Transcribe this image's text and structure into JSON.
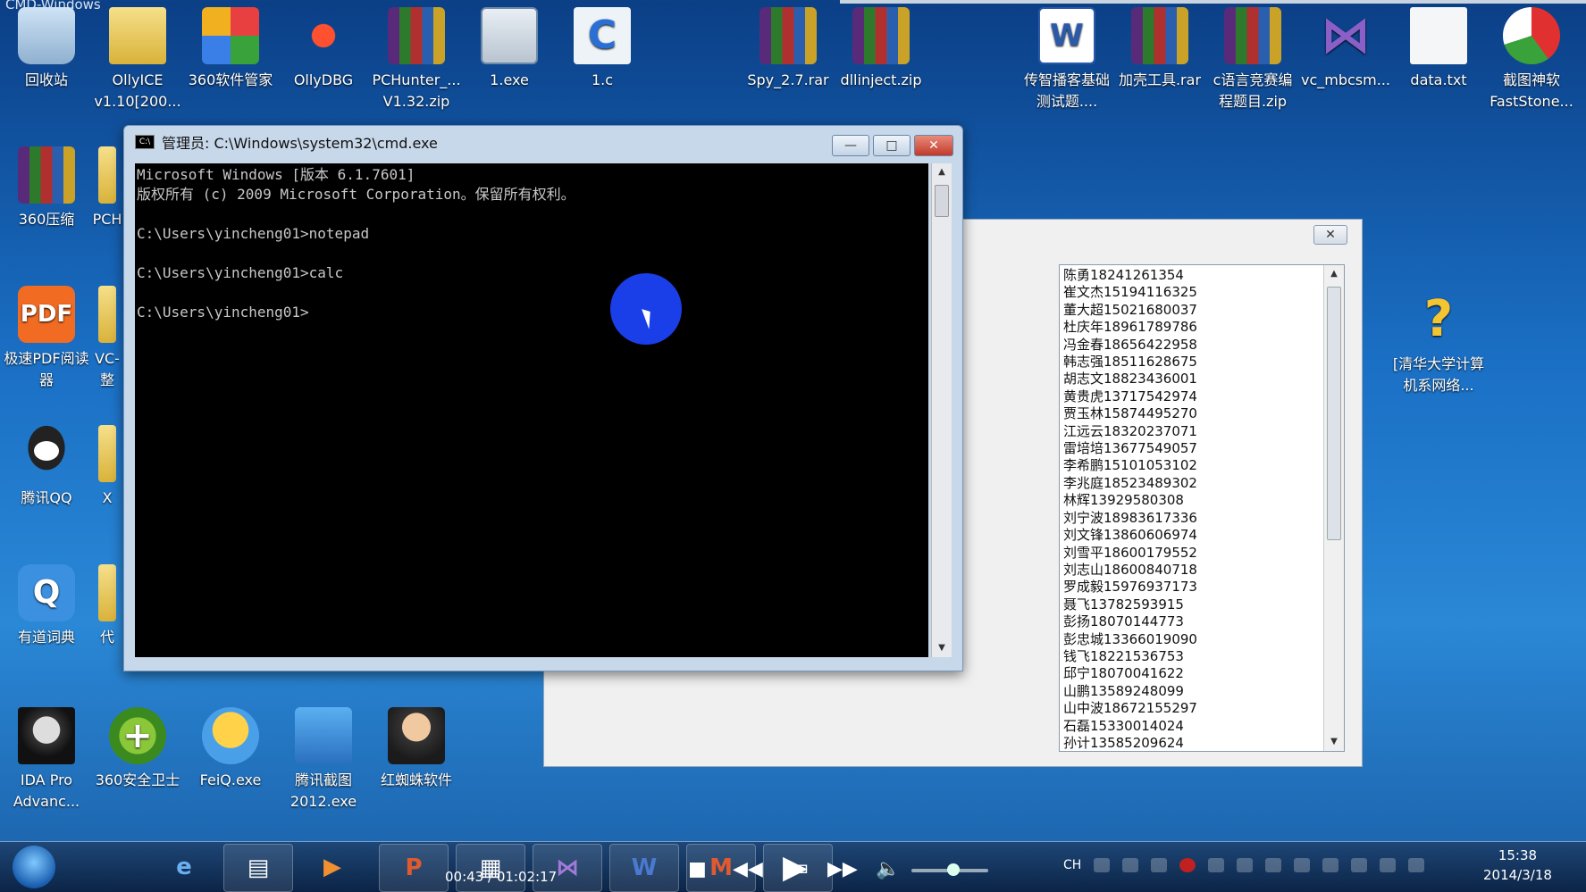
{
  "window_title_strip": "CMD-Windows",
  "desktop_icons": [
    {
      "label": "回收站",
      "icon": "recycle-bin-icon"
    },
    {
      "label": "OllyICE v1.10[200...",
      "icon": "folder-icon"
    },
    {
      "label": "360软件管家",
      "icon": "360-software-manager-icon"
    },
    {
      "label": "OllyDBG",
      "icon": "ollydbg-icon"
    },
    {
      "label": "PCHunter_... V1.32.zip",
      "icon": "rar-archive-icon"
    },
    {
      "label": "1.exe",
      "icon": "exe-icon"
    },
    {
      "label": "1.c",
      "icon": "c-source-icon"
    },
    {
      "label": "Spy_2.7.rar",
      "icon": "rar-archive-icon"
    },
    {
      "label": "dllinject.zip",
      "icon": "rar-archive-icon"
    },
    {
      "label": "传智播客基础测试题....",
      "icon": "word-doc-icon"
    },
    {
      "label": "加壳工具.rar",
      "icon": "rar-archive-icon"
    },
    {
      "label": "c语言竞赛编程题目.zip",
      "icon": "rar-archive-icon"
    },
    {
      "label": "vc_mbcsm...",
      "icon": "visual-studio-icon"
    },
    {
      "label": "data.txt",
      "icon": "text-file-icon"
    },
    {
      "label": "截图神软 FastStone...",
      "icon": "faststone-icon"
    },
    {
      "label": "360压缩",
      "icon": "rar-archive-icon"
    },
    {
      "label": "PCH",
      "icon": "folder-icon"
    },
    {
      "label": "极速PDF阅读器",
      "icon": "pdf-reader-icon"
    },
    {
      "label": "VC-整",
      "icon": "folder-icon"
    },
    {
      "label": "腾讯QQ",
      "icon": "qq-icon"
    },
    {
      "label": "X",
      "icon": "folder-icon"
    },
    {
      "label": "有道词典",
      "icon": "youdao-icon"
    },
    {
      "label": "代",
      "icon": "folder-icon"
    },
    {
      "label": "IDA Pro Advanc...",
      "icon": "ida-pro-icon"
    },
    {
      "label": "360安全卫士",
      "icon": "360-safe-icon"
    },
    {
      "label": "FeiQ.exe",
      "icon": "feiq-icon"
    },
    {
      "label": "腾讯截图2012.exe",
      "icon": "tencent-snapshot-icon"
    },
    {
      "label": "红蜘蛛软件",
      "icon": "red-spider-icon"
    },
    {
      "label": "[清华大学计算机系网络...",
      "icon": "help-file-icon"
    }
  ],
  "cmd_window": {
    "title": "管理员: C:\\Windows\\system32\\cmd.exe",
    "minimize": "—",
    "maximize": "□",
    "close": "✕",
    "lines": [
      "Microsoft Windows [版本 6.1.7601]",
      "版权所有 (c) 2009 Microsoft Corporation。保留所有权利。",
      "",
      "C:\\Users\\yincheng01>notepad",
      "",
      "C:\\Users\\yincheng01>calc",
      "",
      "C:\\Users\\yincheng01>"
    ]
  },
  "list_dialog": {
    "close": "✕",
    "items": [
      "陈勇18241261354",
      "崔文杰15194116325",
      "董大超15021680037",
      "杜庆年18961789786",
      "冯金春18656422958",
      "韩志强18511628675",
      "胡志文18823436001",
      "黄贵虎13717542974",
      "贾玉林15874495270",
      "江远云18320237071",
      "雷培培13677549057",
      "李希鹏15101053102",
      "李兆庭18523489302",
      "林辉13929580308",
      "刘宁波18983617336",
      "刘文锋13860606974",
      "刘雪平18600179552",
      "刘志山18600840718",
      "罗成毅15976937173",
      "聂飞13782593915",
      "彭扬18070144773",
      "彭忠城13366019090",
      "钱飞18221536753",
      "邱宁18070041622",
      "山鹏13589248099",
      "山中波18672155297",
      "石磊15330014024",
      "孙计13585209624"
    ]
  },
  "taskbar": {
    "player_time": "00:43 / 01:02:17",
    "ime": "CH",
    "clock_time": "15:38",
    "clock_date": "2014/3/18"
  }
}
